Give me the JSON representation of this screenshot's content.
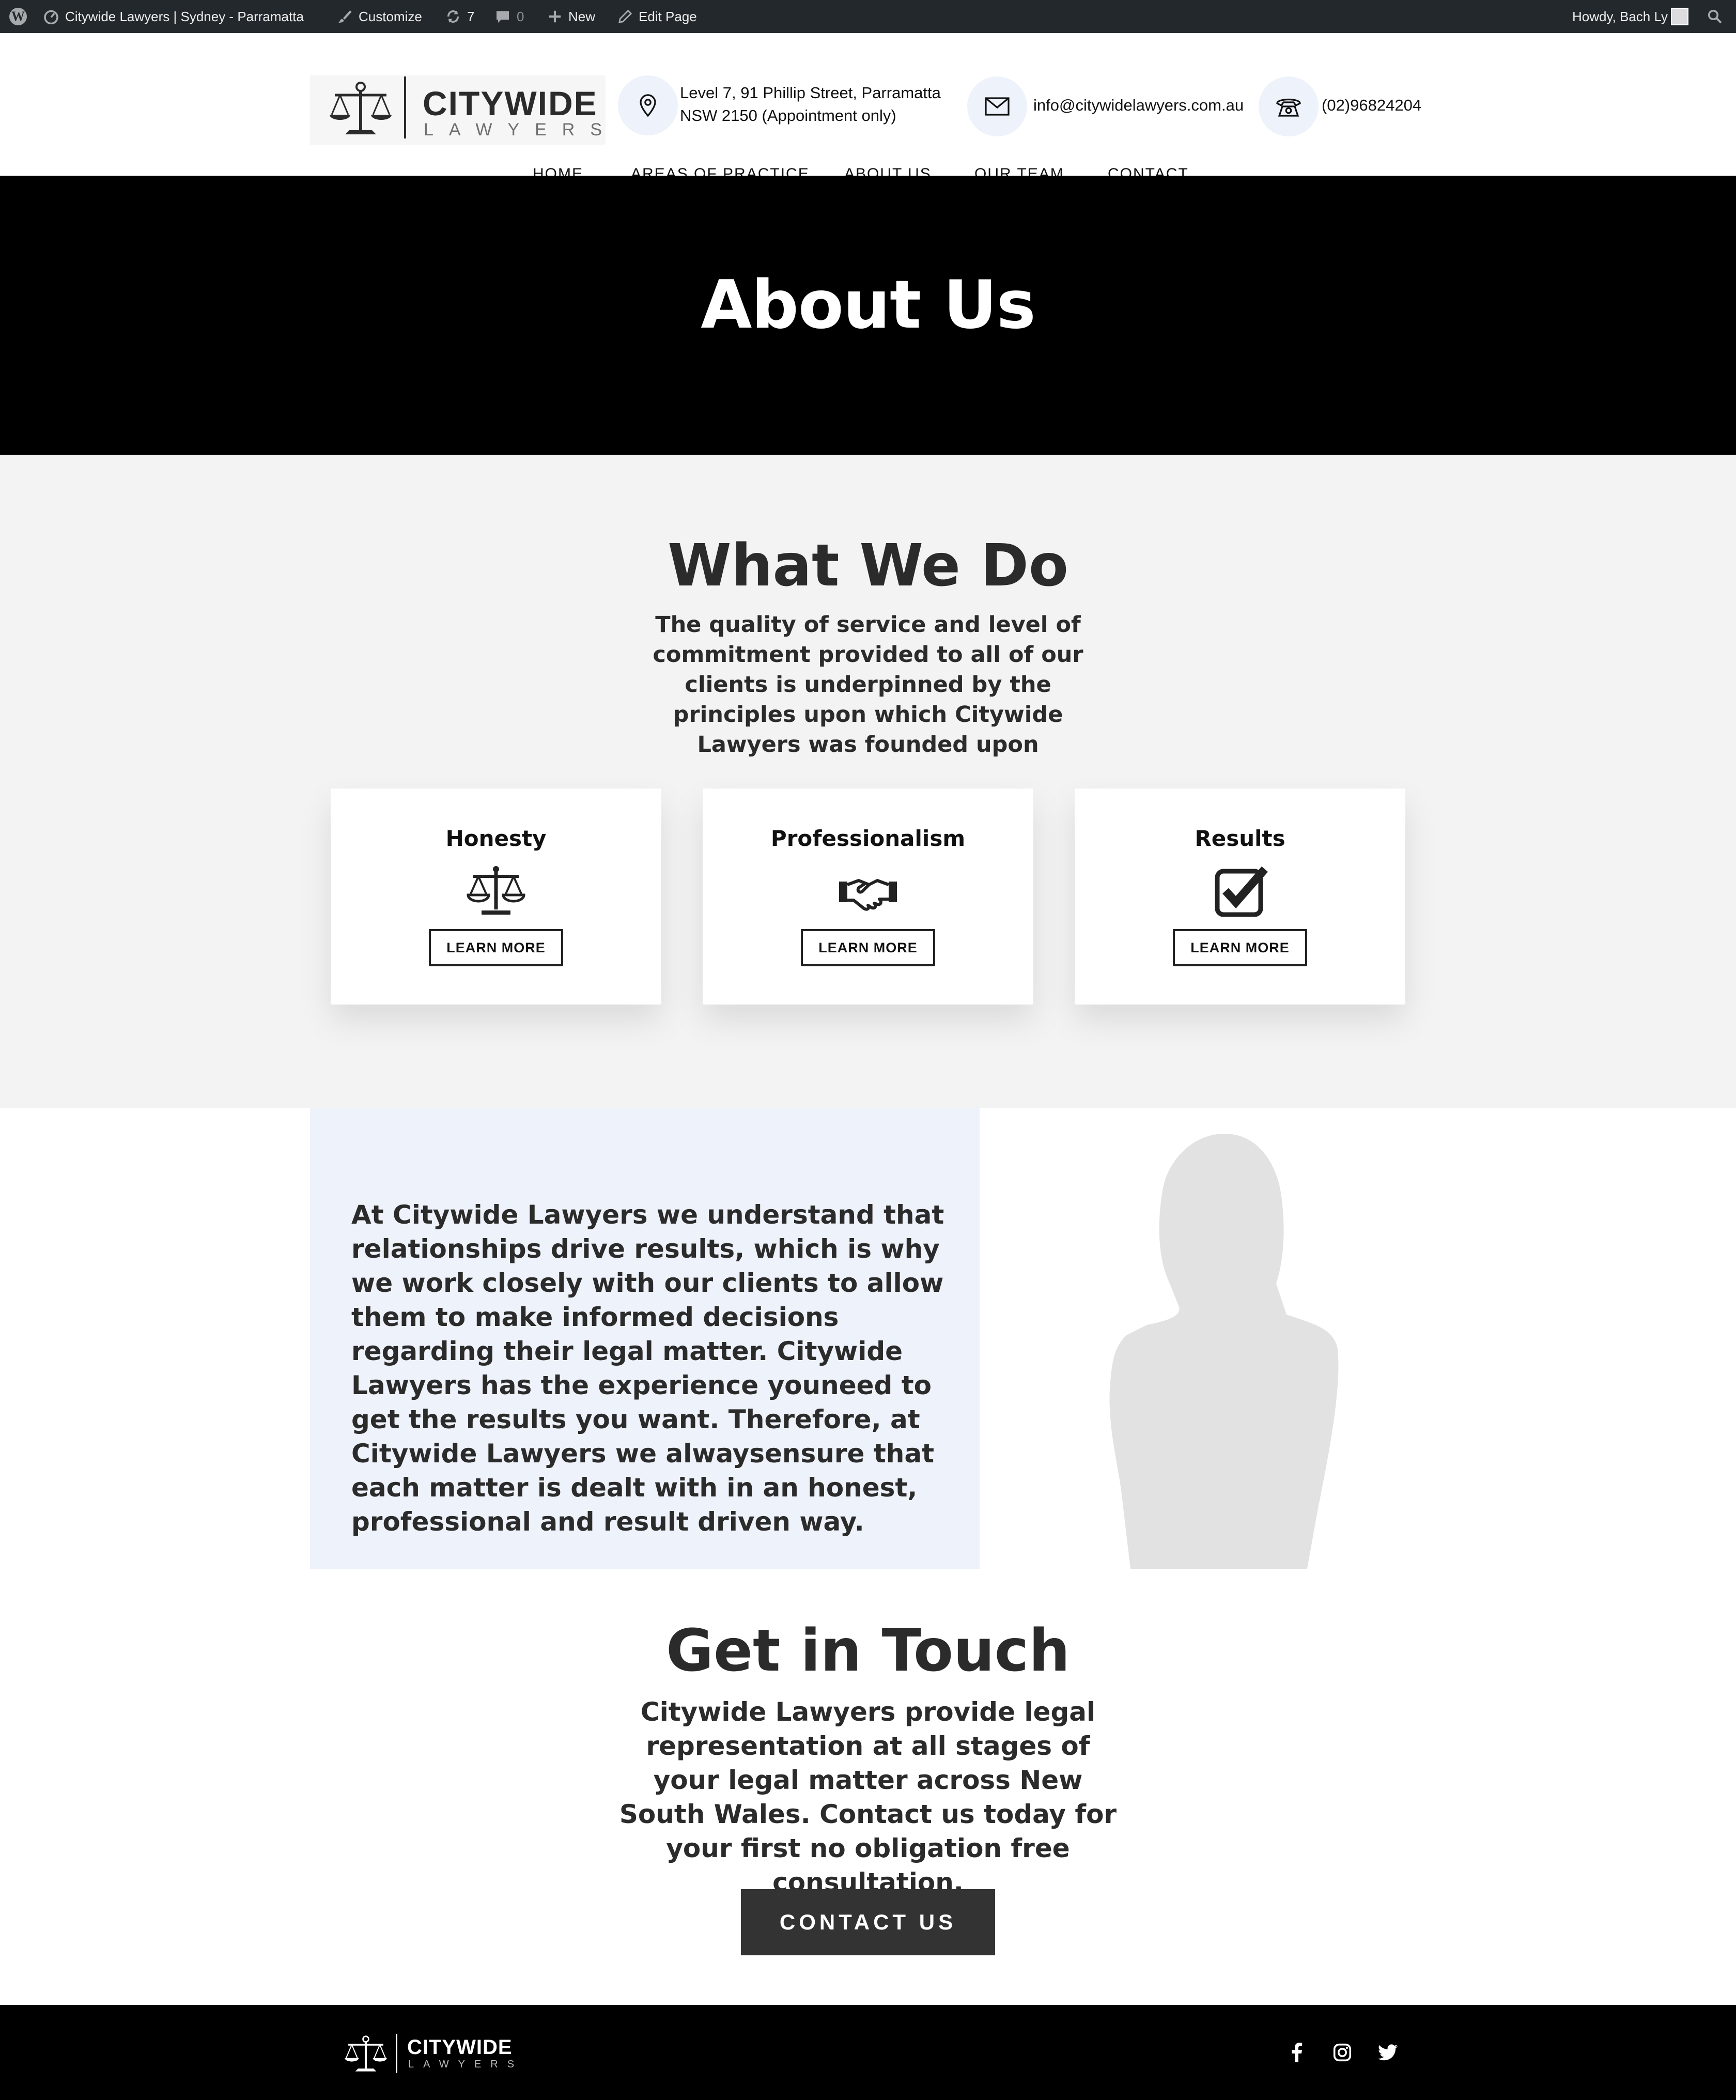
{
  "admin_bar": {
    "site_name": "Citywide Lawyers | Sydney - Parramatta",
    "customize": "Customize",
    "updates_count": "7",
    "comments_count": "0",
    "new": "New",
    "edit_page": "Edit Page",
    "howdy": "Howdy, Bach Ly"
  },
  "header": {
    "logo_word1": "CITYWIDE",
    "logo_word2": "LAWYERS",
    "address_line1": "Level 7, 91 Phillip Street, Parramatta",
    "address_line2": "NSW 2150 (Appointment only)",
    "email": "info@citywidelawyers.com.au",
    "phone": "(02)96824204"
  },
  "nav": {
    "items": [
      "HOME",
      "AREAS OF PRACTICE",
      "ABOUT US",
      "OUR TEAM",
      "CONTACT"
    ]
  },
  "hero": {
    "title": "About Us"
  },
  "what_we_do": {
    "title": "What We Do",
    "subtitle": "The quality of service and level of commitment provided to all of our clients is underpinned by the principles upon which Citywide Lawyers was founded upon",
    "cards": [
      {
        "title": "Honesty",
        "icon": "scales-icon",
        "button": "LEARN MORE"
      },
      {
        "title": "Professionalism",
        "icon": "handshake-icon",
        "button": "LEARN MORE"
      },
      {
        "title": "Results",
        "icon": "checkbox-icon",
        "button": "LEARN MORE"
      }
    ]
  },
  "about": {
    "text": "At Citywide Lawyers we understand that relationships drive results, which is why we work closely with our clients to allow them to make informed decisions regarding their legal matter. Citywide Lawyers has the experience youneed to get the results you want. Therefore, at Citywide Lawyers we alwaysensure that each matter is dealt with in an honest, professional and result driven way."
  },
  "get_in_touch": {
    "title": "Get in Touch",
    "text": "Citywide Lawyers provide legal representation at all stages of your legal matter across New South Wales. Contact us today for your first no obligation free consultation.",
    "button": "CONTACT US"
  },
  "footer": {
    "logo_word1": "CITYWIDE",
    "logo_word2": "LAWYERS",
    "social": [
      "facebook-icon",
      "instagram-icon",
      "twitter-icon"
    ]
  },
  "colors": {
    "admin_bar_bg": "#23282d",
    "hero_bg": "#000000",
    "section_bg": "#f3f3f3",
    "accent_light": "#eef2fa",
    "button_dark": "#333333"
  }
}
